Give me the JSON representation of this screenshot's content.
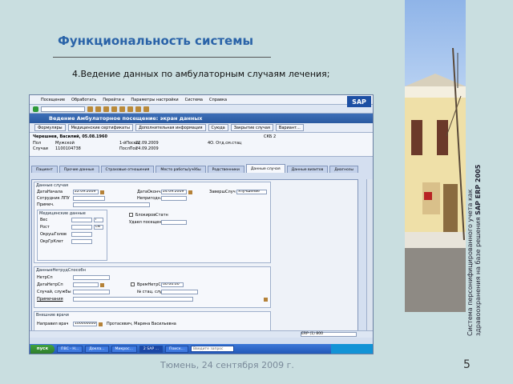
{
  "slide": {
    "title": "Функциональность системы",
    "subtitle": "4.Ведение данных по амбулаторным случаям лечения;",
    "footer": "Тюмень, 24 сентября 2009 г.",
    "page": "5",
    "vertical_text": "Система персонифицированного учета как здравоохранения на базе решения",
    "vertical_bold": "SAP ERP 2005"
  },
  "sap": {
    "menu": [
      "Посещение",
      "Обработать",
      "Перейти к",
      "Параметры настройки",
      "Система",
      "Справка"
    ],
    "logo": "SAP",
    "title": "Ведение Амбулаторное посещение: экран данных",
    "toolbar_buttons": [
      "Формуляры",
      "Медицинские сертификаты",
      "Дополнительная информация",
      "Суюда",
      "Закрытие случая",
      "Вариант..."
    ],
    "header": {
      "name": "Черешнев, Василий, 05.08.1960",
      "pol_label": "Пол",
      "pol": "Мужской",
      "status_label": "Случаи",
      "status": "1100104738",
      "first_label": "1-йПосещ",
      "first": "22.09.2009",
      "last_label": "ПослПос",
      "last": "24.09.2009",
      "org": "4О. Отд.см.стац",
      "ske": "СКБ 2"
    },
    "tabs": [
      "Пациент",
      "Прочие данные",
      "Страховые отношения",
      "Место работы/учёбы",
      "Родственники",
      "Данные случая",
      "Данные визитов",
      "Диагнозы"
    ],
    "active_tab": "Данные случая",
    "case": {
      "group": "Данные случая",
      "date_label": "ДатаНачала",
      "date": "22.09.2009",
      "staff_label": "Сотрудник ЛПУ",
      "note_label": "Примеч.",
      "end_label": "ДатаОконч.",
      "end": "24.09.2009",
      "unfit_label": "Непригодн.",
      "close_label": "ЗавершСлуч",
      "close": "Улучшение"
    },
    "medical": {
      "group": "Медицинские данные",
      "weight_label": "Вес",
      "weight_unit": "г",
      "height_label": "Рост",
      "height_unit": "см",
      "head_label": "ОкрушГолов",
      "chest_label": "ОкрГрКлет",
      "hemo_check": "БлокировСтатн",
      "hemo_label": "Удаел посещения"
    },
    "inability": {
      "group": "ДанныеНетрудСпособн",
      "doc_label": "НетрСп",
      "date_label": "ДатаНетрСп",
      "case_label": "Случай, службы",
      "note_label": "Примечания",
      "time_label": "ВремНетрСп",
      "time": "00:00:00",
      "stat_label": "№ стац. службы"
    },
    "external": {
      "group": "Внешние врачи",
      "doctor_label": "Направил врач",
      "doctor_id": "1000000009",
      "doctor_name": "Протасевич, Марина Васильевна"
    },
    "status_bar": "ERP (1) 800"
  },
  "taskbar": {
    "start": "пуск",
    "tasks": [
      "ПВС - Н...",
      "Докла...",
      "Микрос...",
      "2 SAP ...",
      "Поиск..."
    ],
    "search_placeholder": "Введите запрос"
  }
}
